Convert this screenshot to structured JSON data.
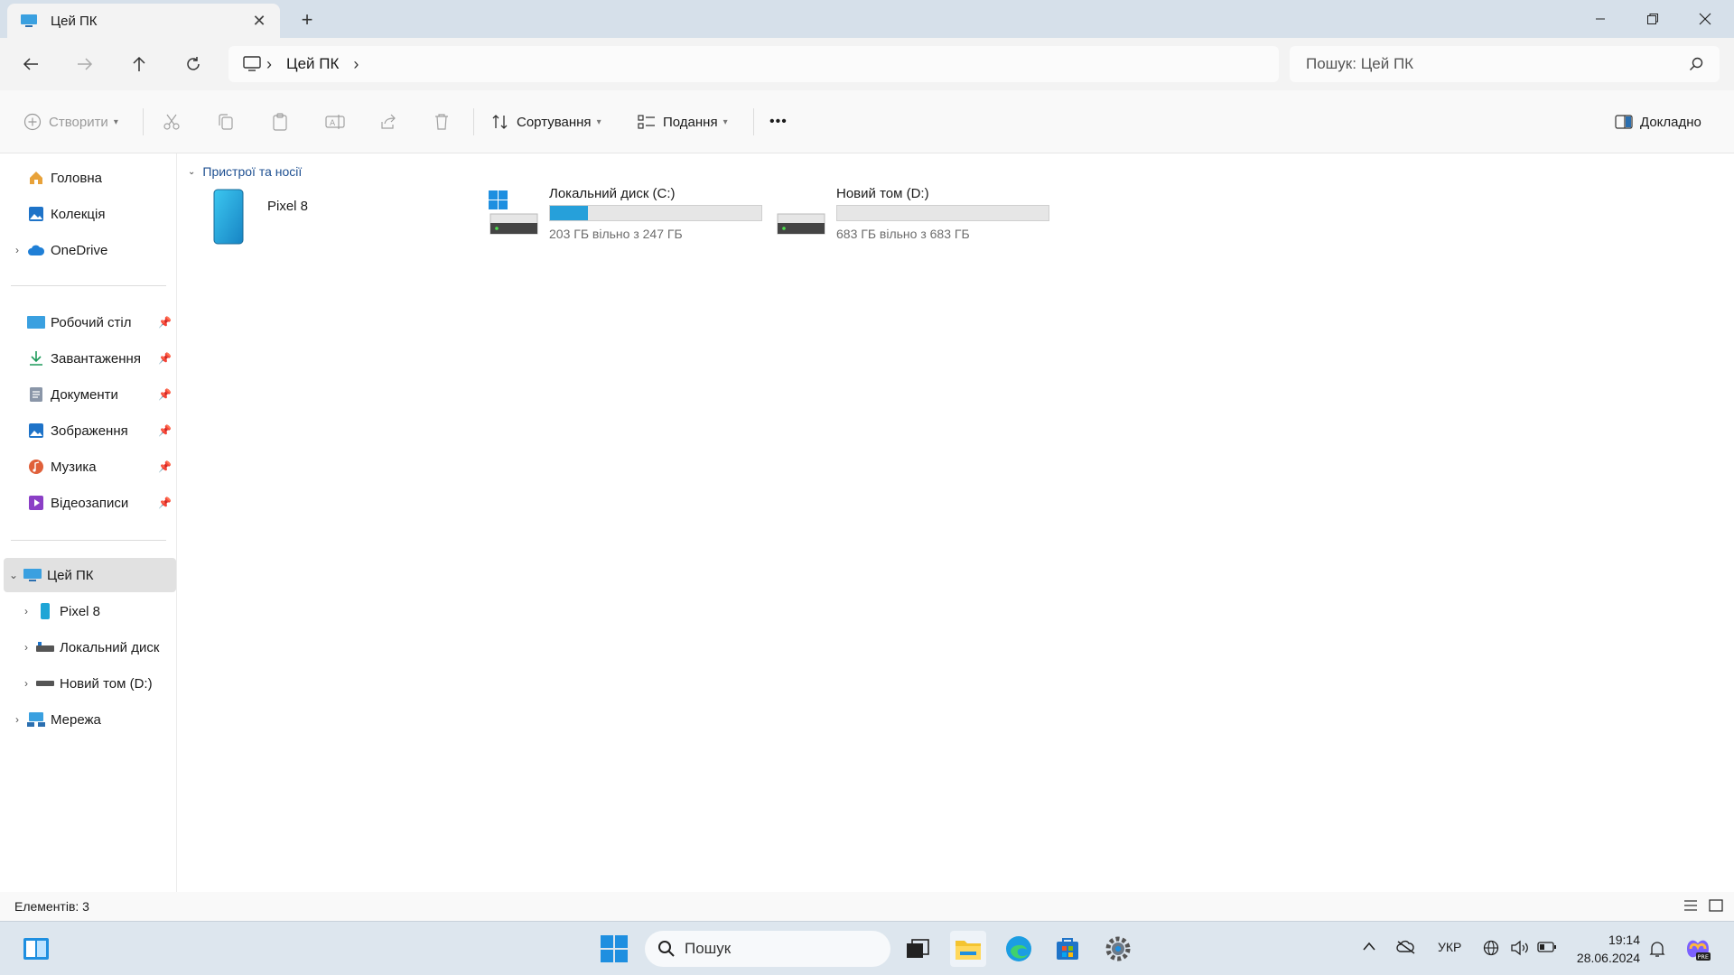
{
  "window": {
    "tab_title": "Цей ПК",
    "new_tab": "+",
    "close_tab": "✕"
  },
  "address": {
    "crumbs": [
      "Цей ПК"
    ],
    "search_placeholder": "Пошук: Цей ПК"
  },
  "toolbar": {
    "create_label": "Створити",
    "sort_label": "Сортування",
    "view_label": "Подання",
    "more_label": "•••",
    "details_label": "Докладно"
  },
  "sidebar": {
    "top_items": [
      {
        "label": "Головна",
        "icon": "home-icon"
      },
      {
        "label": "Колекція",
        "icon": "gallery-icon"
      },
      {
        "label": "OneDrive",
        "icon": "cloud-icon"
      }
    ],
    "pinned_items": [
      {
        "label": "Робочий стіл",
        "icon": "desktop-icon"
      },
      {
        "label": "Завантаження",
        "icon": "download-icon"
      },
      {
        "label": "Документи",
        "icon": "document-icon"
      },
      {
        "label": "Зображення",
        "icon": "pictures-icon"
      },
      {
        "label": "Музика",
        "icon": "music-icon"
      },
      {
        "label": "Відеозаписи",
        "icon": "video-icon"
      }
    ],
    "tree_items": [
      {
        "label": "Цей ПК",
        "icon": "pc-icon"
      },
      {
        "label": "Pixel 8",
        "icon": "phone-icon"
      },
      {
        "label": "Локальний диск",
        "icon": "drive-icon"
      },
      {
        "label": "Новий том (D:)",
        "icon": "drive-icon"
      },
      {
        "label": "Мережа",
        "icon": "network-icon"
      }
    ]
  },
  "content": {
    "group_title": "Пристрої та носії",
    "devices": [
      {
        "name": "Pixel 8",
        "icon": "phone-icon"
      },
      {
        "name": "Локальний диск (C:)",
        "free_text": "203 ГБ вільно з 247 ГБ",
        "used_fraction": 0.18,
        "icon": "windows-drive-icon"
      },
      {
        "name": "Новий том (D:)",
        "free_text": "683 ГБ вільно з 683 ГБ",
        "used_fraction": 0.0,
        "icon": "drive-icon"
      }
    ]
  },
  "status": {
    "items_count": "Елементів: 3"
  },
  "taskbar": {
    "search_placeholder": "Пошук",
    "language": "УКР",
    "time": "19:14",
    "date": "28.06.2024"
  },
  "colors": {
    "accent": "#26a0da",
    "folder_link": "#1d4f91",
    "selection": "#e1e1e1"
  }
}
